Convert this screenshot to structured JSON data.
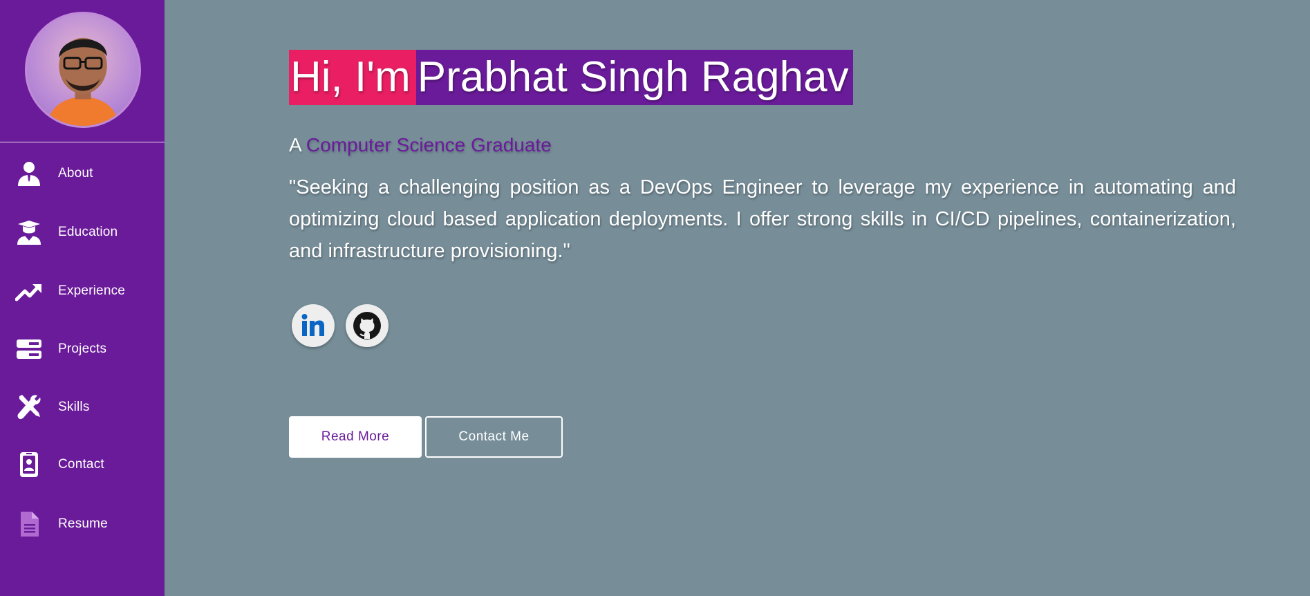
{
  "sidebar": {
    "avatar_alt": "profile photo",
    "items": [
      {
        "label": "About",
        "icon": "person-icon"
      },
      {
        "label": "Education",
        "icon": "graduation-icon"
      },
      {
        "label": "Experience",
        "icon": "trending-up-icon"
      },
      {
        "label": "Projects",
        "icon": "server-icon"
      },
      {
        "label": "Skills",
        "icon": "tools-icon"
      },
      {
        "label": "Contact",
        "icon": "contact-card-icon"
      },
      {
        "label": "Resume",
        "icon": "document-icon"
      }
    ]
  },
  "hero": {
    "greeting": "Hi, I'm",
    "name": "Prabhat Singh Raghav",
    "subtitle_prefix": "A",
    "subtitle_role": "Computer Science Graduate",
    "objective": "\"Seeking a challenging position as a DevOps Engineer to leverage my experience in automating and optimizing cloud based application deployments. I offer strong skills in CI/CD pipelines, containerization, and infrastructure provisioning.\""
  },
  "social": {
    "linkedin_icon": "linkedin-icon",
    "github_icon": "github-icon"
  },
  "buttons": {
    "read_more": "Read More",
    "contact_me": "Contact Me"
  },
  "colors": {
    "sidebar": "#6a1b9a",
    "background": "#778e99",
    "greeting_highlight": "#e91e63",
    "name_highlight": "#6a1b9a",
    "accent": "#6a1b9a"
  }
}
